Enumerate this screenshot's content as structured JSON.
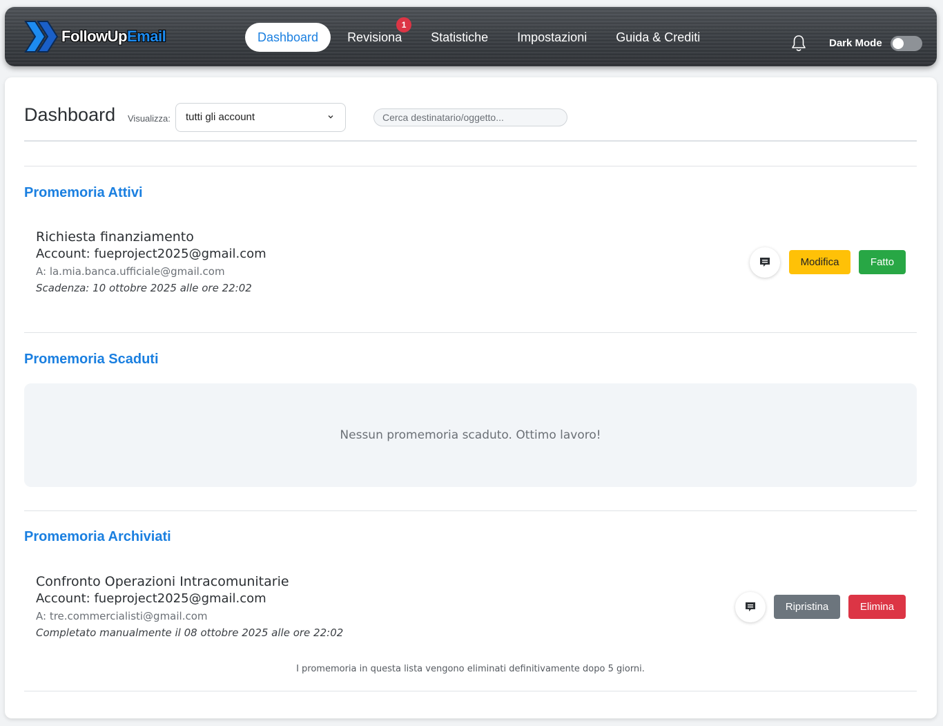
{
  "brand": {
    "part1": "FollowUp",
    "part2": "Email",
    "primary": "#1a7fe0"
  },
  "nav": {
    "items": [
      {
        "label": "Dashboard",
        "active": true
      },
      {
        "label": "Revisiona",
        "badge": "1"
      },
      {
        "label": "Statistiche"
      },
      {
        "label": "Impostazioni"
      },
      {
        "label": "Guida & Crediti"
      }
    ],
    "bell_icon": "bell-icon",
    "dark_mode_label": "Dark Mode",
    "dark_mode_on": false
  },
  "header": {
    "title": "Dashboard",
    "view_label": "Visualizza:",
    "view_selected": "tutti gli account",
    "search_placeholder": "Cerca destinatario/oggetto..."
  },
  "active": {
    "title": "Promemoria Attivi",
    "items": [
      {
        "subject": "Richiesta finanziamento",
        "account": "Account: fueproject2025@gmail.com",
        "to": "A: la.mia.banca.ufficiale@gmail.com",
        "date": "Scadenza: 10 ottobre 2025 alle ore 22:02",
        "edit_label": "Modifica",
        "done_label": "Fatto"
      }
    ]
  },
  "expired": {
    "title": "Promemoria Scaduti",
    "empty_message": "Nessun promemoria scaduto. Ottimo lavoro!"
  },
  "archived": {
    "title": "Promemoria Archiviati",
    "items": [
      {
        "subject": "Confronto Operazioni Intracomunitarie",
        "account": "Account: fueproject2025@gmail.com",
        "to": "A: tre.commercialisti@gmail.com",
        "date": "Completato manualmente il 08 ottobre 2025 alle ore 22:02",
        "restore_label": "Ripristina",
        "delete_label": "Elimina"
      }
    ],
    "footnote": "I promemoria in questa lista vengono eliminati definitivamente dopo 5 giorni."
  }
}
